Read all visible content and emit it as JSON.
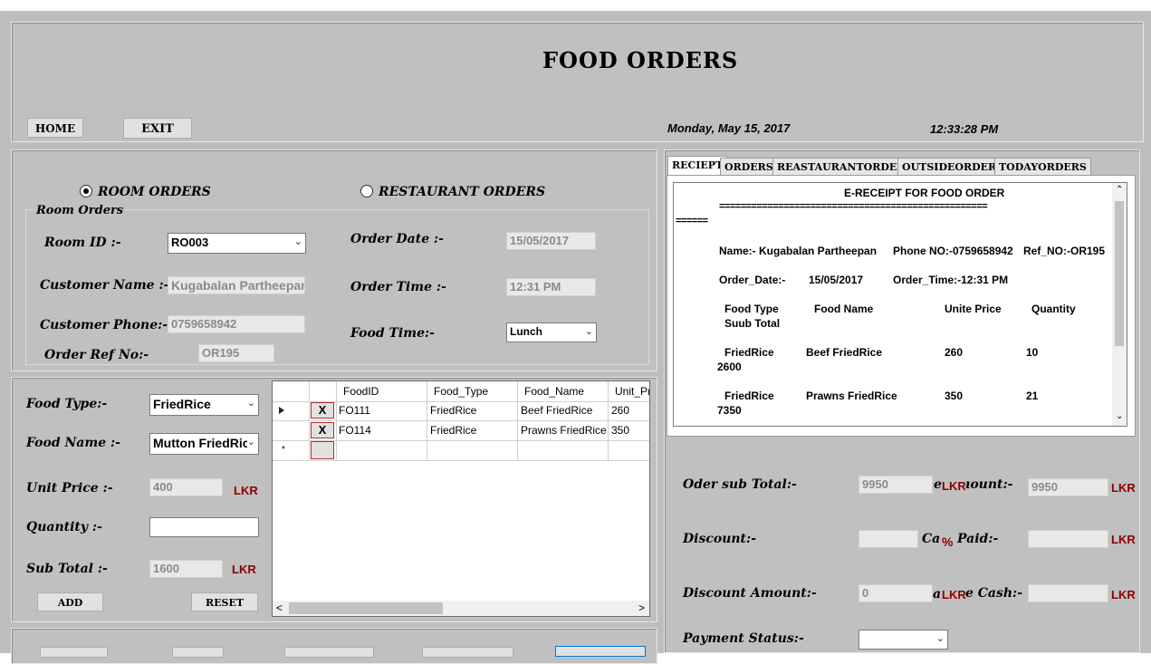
{
  "header": {
    "title": "FOOD ORDERS",
    "home_label": "HOME",
    "exit_label": "EXIT",
    "date": "Monday, May 15, 2017",
    "time": "12:33:28 PM"
  },
  "order_type": {
    "room_label": "ROOM ORDERS",
    "restaurant_label": "RESTAURANT ORDERS",
    "group_label": "Room Orders"
  },
  "room_form": {
    "room_id_label": "Room ID :-",
    "room_id_value": "RO003",
    "customer_name_label": "Customer Name :-",
    "customer_name_value": "Kugabalan Partheepan",
    "customer_phone_label": "Customer Phone:-",
    "customer_phone_value": "0759658942",
    "order_ref_label": "Order Ref No:-",
    "order_ref_value": "OR195",
    "order_date_label": "Order Date :-",
    "order_date_value": "15/05/2017",
    "order_time_label": "Order Time :-",
    "order_time_value": "12:31 PM",
    "food_time_label": "Food Time:-",
    "food_time_value": "Lunch"
  },
  "food_form": {
    "food_type_label": "Food Type:-",
    "food_type_value": "FriedRice",
    "food_name_label": "Food Name :-",
    "food_name_value": "Mutton FriedRic",
    "unit_price_label": "Unit Price :-",
    "unit_price_value": "400",
    "quantity_label": "Quantity :-",
    "quantity_value": "",
    "sub_total_label": "Sub Total :-",
    "sub_total_value": "1600",
    "currency": "LKR",
    "add_label": "ADD",
    "reset_label": "RESET"
  },
  "grid": {
    "columns": [
      "FoodID",
      "Food_Type",
      "Food_Name",
      "Unit_Pri"
    ],
    "rows": [
      {
        "delete": "X",
        "food_id": "FO111",
        "food_type": "FriedRice",
        "food_name": "Beef FriedRice",
        "unit_price": "260"
      },
      {
        "delete": "X",
        "food_id": "FO114",
        "food_type": "FriedRice",
        "food_name": "Prawns FriedRice",
        "unit_price": "350"
      }
    ],
    "new_row_marker": "*",
    "scroll_left": "<",
    "scroll_right": ">"
  },
  "tabs": [
    "RECIEPT",
    "ORDERS",
    "REASTAURANTORDERS",
    "OUTSIDEORDERS",
    "TODAYORDERS"
  ],
  "receipt": {
    "heading": "E-RECEIPT FOR FOOD ORDER",
    "separator": "==================================================",
    "separator_tail": "======",
    "name": "Name:-    Kugabalan Partheepan",
    "phone": "Phone NO:-0759658942",
    "ref": "Ref_NO:-OR195",
    "order_date": "Order_Date:-",
    "order_date_value": "15/05/2017",
    "order_time": "Order_Time:-12:31 PM",
    "col_food_type": "Food Type",
    "col_sub_total": "Suub Total",
    "col_food_name": "Food Name",
    "col_unit_price": "Unite Price",
    "col_quantity": "Quantity",
    "items": [
      {
        "type": "FriedRice",
        "name": "Beef FriedRice",
        "price": "260",
        "qty": "10",
        "total": "2600"
      },
      {
        "type": "FriedRice",
        "name": "Prawns FriedRice",
        "price": "350",
        "qty": "21",
        "total": "7350"
      }
    ]
  },
  "payment": {
    "sub_total_label": "Oder sub Total:-",
    "sub_total_value": "9950",
    "amount_label_prefix": "e",
    "amount_label_suffix": "ıount:-",
    "amount_value": "9950",
    "discount_label": "Discount:-",
    "discount_value": "",
    "percent": "%",
    "paid_label_prefix": "Ca",
    "paid_label_suffix": "Paid:-",
    "paid_value": "",
    "discount_amount_label": "Discount Amount:-",
    "discount_amount_value": "0",
    "cash_label_prefix": "a",
    "cash_label_suffix": "e Cash:-",
    "cash_value": "",
    "status_label": "Payment Status:-",
    "status_value": "",
    "currency": "LKR"
  },
  "colors": {
    "window_bg": "#bdbdbd",
    "currency_red": "#8b0000"
  }
}
